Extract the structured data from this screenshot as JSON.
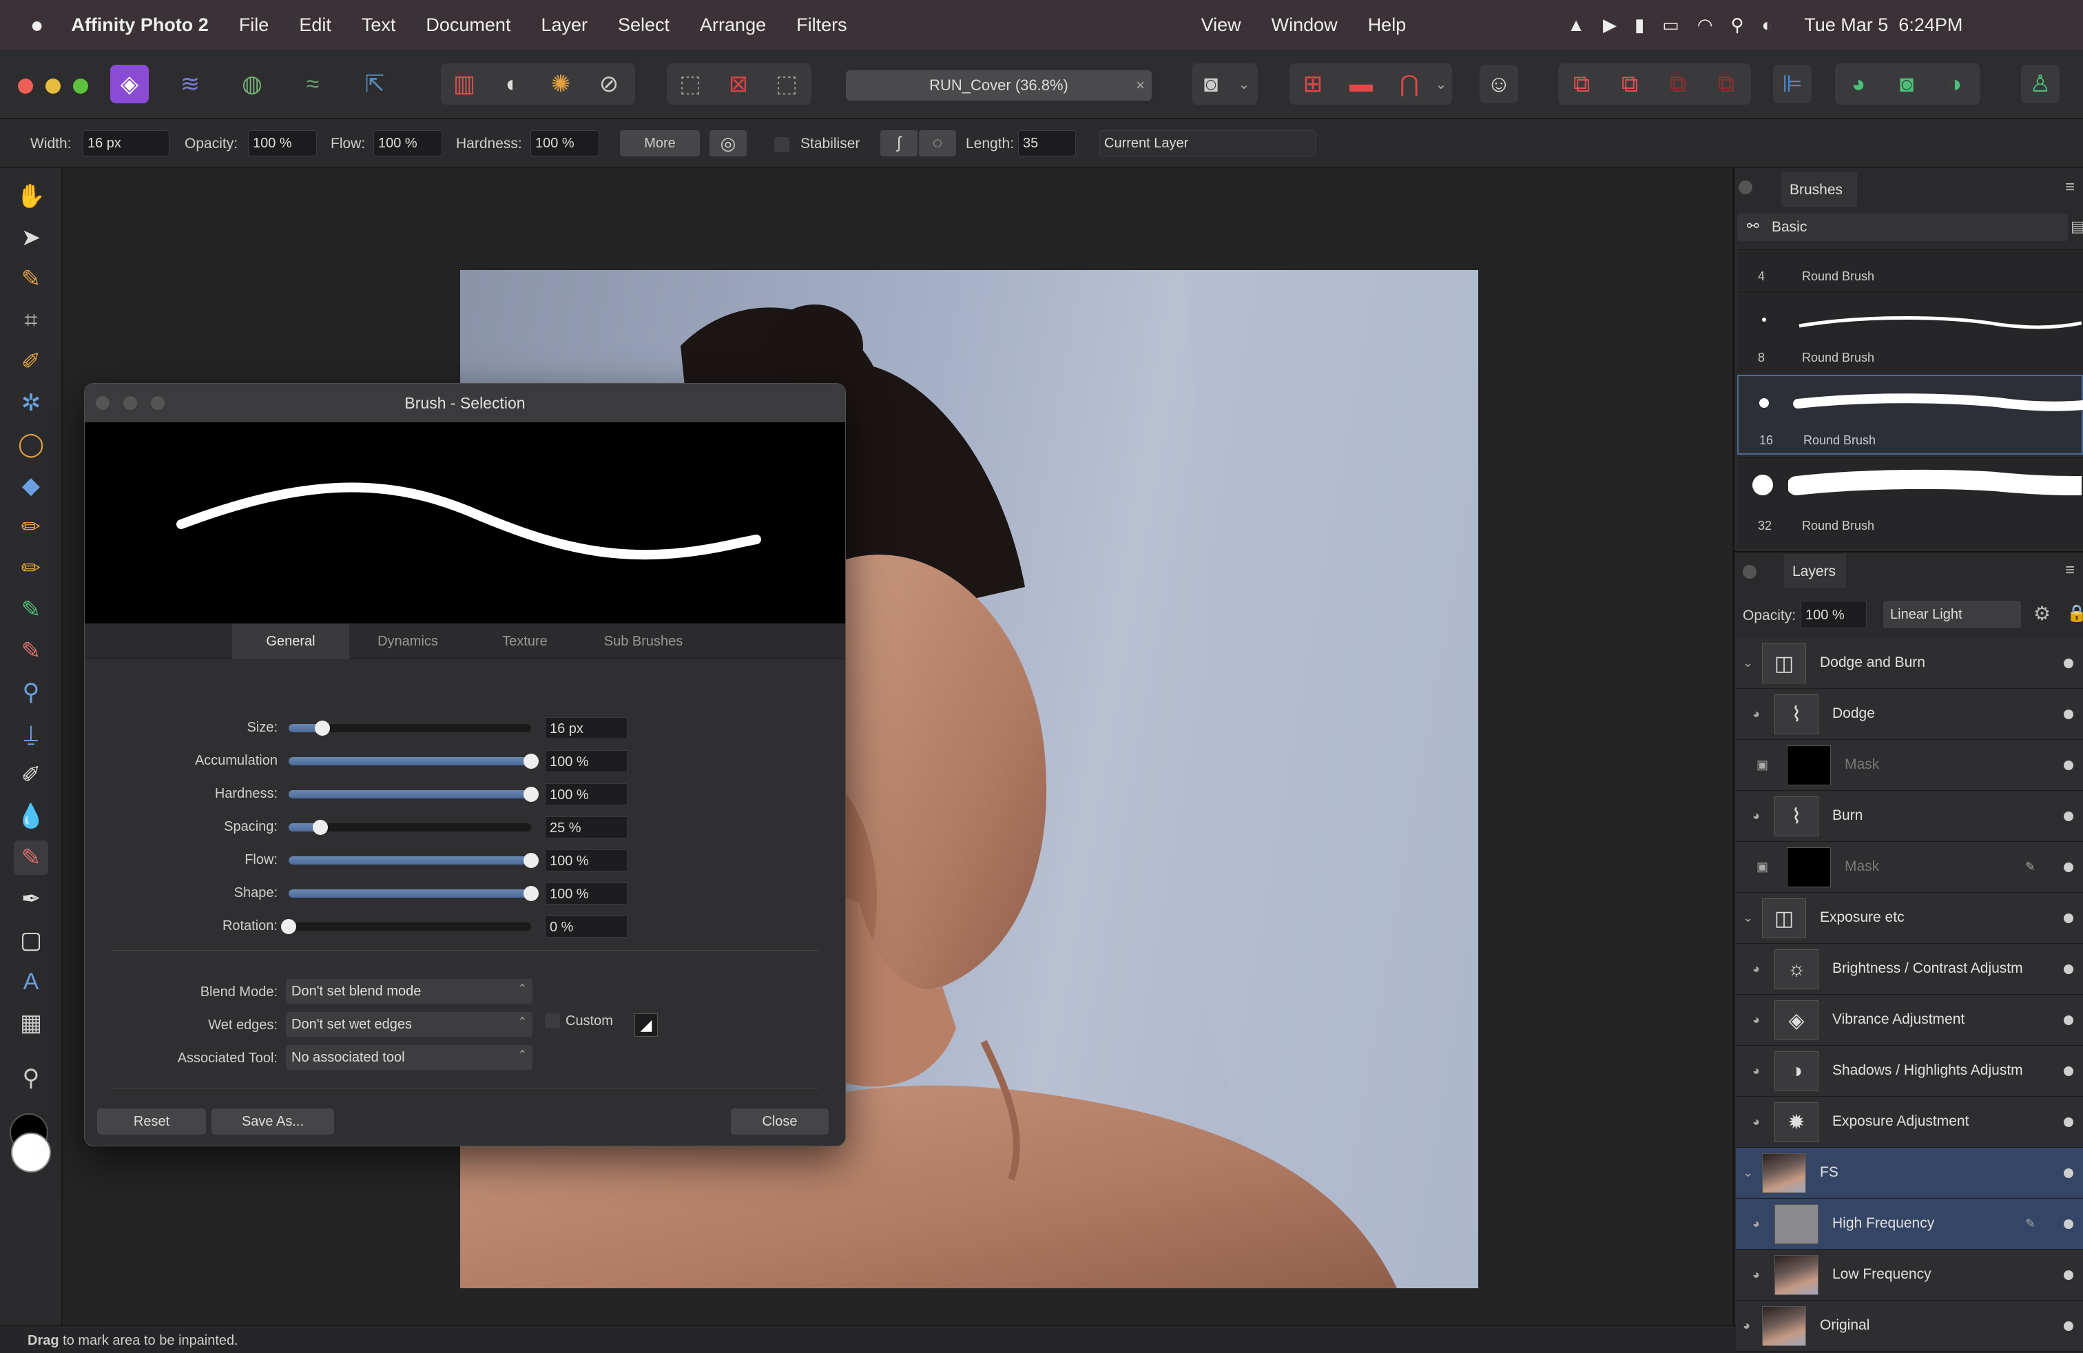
{
  "menubar": {
    "app_name": "Affinity Photo 2",
    "items": [
      "File",
      "Edit",
      "Text",
      "Document",
      "Layer",
      "Select",
      "Arrange",
      "Filters"
    ],
    "right_items": [
      "View",
      "Window",
      "Help"
    ],
    "clock": "Tue Mar 5  6:24PM"
  },
  "toolbar": {
    "document_title": "RUN_Cover (36.8%)",
    "close_glyph": "×"
  },
  "context": {
    "width_label": "Width:",
    "width_value": "16 px",
    "opacity_label": "Opacity:",
    "opacity_value": "100 %",
    "flow_label": "Flow:",
    "flow_value": "100 %",
    "hardness_label": "Hardness:",
    "hardness_value": "100 %",
    "more_label": "More",
    "stabiliser_label": "Stabiliser",
    "length_label": "Length:",
    "length_value": "35",
    "layer_target": "Current Layer"
  },
  "dialog": {
    "title": "Brush - Selection",
    "tabs": [
      "General",
      "Dynamics",
      "Texture",
      "Sub Brushes"
    ],
    "active_tab": "General",
    "settings": [
      {
        "label": "Size:",
        "value": "16 px",
        "level": 0.14
      },
      {
        "label": "Accumulation",
        "value": "100 %",
        "level": 1.0
      },
      {
        "label": "Hardness:",
        "value": "100 %",
        "level": 1.0
      },
      {
        "label": "Spacing:",
        "value": "25 %",
        "level": 0.13
      },
      {
        "label": "Flow:",
        "value": "100 %",
        "level": 1.0
      },
      {
        "label": "Shape:",
        "value": "100 %",
        "level": 1.0
      },
      {
        "label": "Rotation:",
        "value": "0 %",
        "level": 0.0
      }
    ],
    "blend_mode_label": "Blend Mode:",
    "blend_mode_value": "Don't set blend mode",
    "wet_edges_label": "Wet edges:",
    "wet_edges_value": "Don't set wet edges",
    "custom_label": "Custom",
    "associated_tool_label": "Associated Tool:",
    "associated_tool_value": "No associated tool",
    "reset_label": "Reset",
    "save_as_label": "Save As...",
    "close_label": "Close"
  },
  "brushes": {
    "panel_title": "Brushes",
    "category": "Basic",
    "items": [
      {
        "size": "4",
        "name": "Round Brush"
      },
      {
        "size": "8",
        "name": "Round Brush"
      },
      {
        "size": "16",
        "name": "Round Brush"
      },
      {
        "size": "32",
        "name": "Round Brush"
      }
    ],
    "selected_size": "16"
  },
  "layers": {
    "panel_title": "Layers",
    "opacity_label": "Opacity:",
    "opacity_value": "100 %",
    "blend_mode": "Linear Light",
    "items": [
      {
        "name": "Dodge and Burn"
      },
      {
        "name": "Dodge"
      },
      {
        "name": "Mask"
      },
      {
        "name": "Burn"
      },
      {
        "name": "Mask"
      },
      {
        "name": "Exposure etc"
      },
      {
        "name": "Brightness / Contrast Adjustm"
      },
      {
        "name": "Vibrance Adjustment"
      },
      {
        "name": "Shadows / Highlights Adjustm"
      },
      {
        "name": "Exposure Adjustment"
      },
      {
        "name": "FS"
      },
      {
        "name": "High Frequency"
      },
      {
        "name": "Low Frequency"
      },
      {
        "name": "Original"
      }
    ],
    "selected": "High Frequency"
  },
  "status": {
    "bold": "Drag",
    "text": " to mark area to be inpainted."
  },
  "colors": {
    "selection_accent": "#4d6a96",
    "slider_fill": "#5b79a8",
    "menubar_bg": "#3a3236"
  }
}
